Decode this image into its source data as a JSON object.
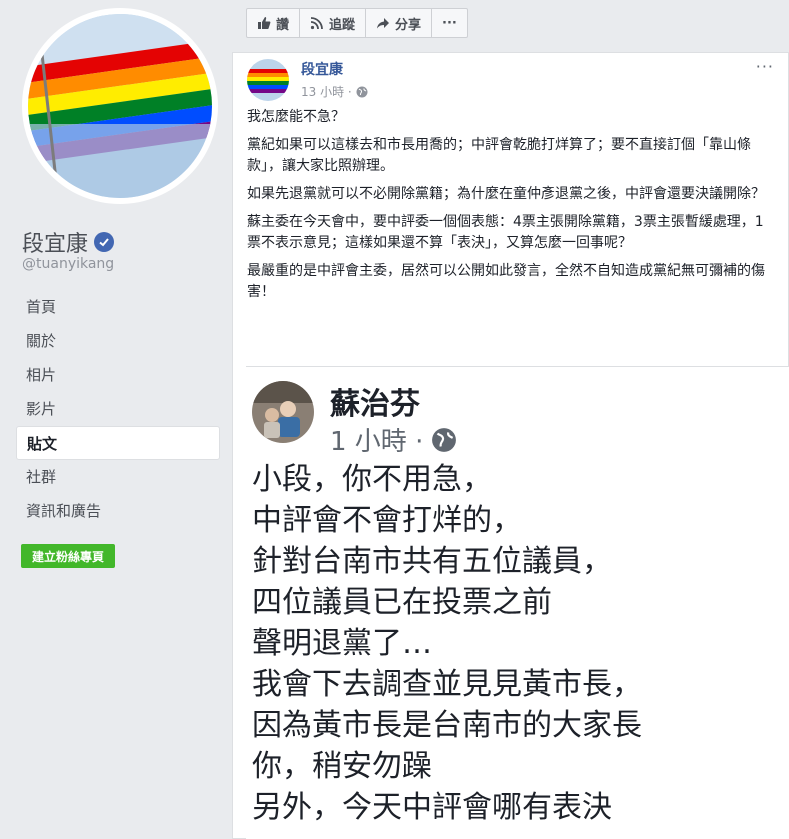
{
  "page": {
    "name": "段宜康",
    "handle": "@tuanyikang"
  },
  "nav": [
    {
      "label": "首頁",
      "active": false
    },
    {
      "label": "關於",
      "active": false
    },
    {
      "label": "相片",
      "active": false
    },
    {
      "label": "影片",
      "active": false
    },
    {
      "label": "貼文",
      "active": true
    },
    {
      "label": "社群",
      "active": false
    },
    {
      "label": "資訊和廣告",
      "active": false
    }
  ],
  "create_page_button": "建立粉絲專頁",
  "actionbar": {
    "like": "讚",
    "follow": "追蹤",
    "share": "分享",
    "more": "···"
  },
  "post": {
    "author": "段宜康",
    "time": "13 小時 ·",
    "more": "···",
    "paragraphs": [
      "我怎麼能不急？",
      "黨紀如果可以這樣去和市長用喬的；中評會乾脆打烊算了；要不直接訂個「靠山條款」，讓大家比照辦理。",
      "如果先退黨就可以不必開除黨籍；為什麼在童仲彥退黨之後，中評會還要決議開除？",
      "蘇主委在今天會中，要中評委一個個表態：4票主張開除黨籍，3票主張暫緩處理，1票不表示意見；這樣如果還不算「表決」，又算怎麼一回事呢？",
      "最嚴重的是中評會主委，居然可以公開如此發言，全然不自知造成黨紀無可彌補的傷害！"
    ]
  },
  "shared_image": {
    "author": "蘇治芬",
    "time": "1 小時 ·",
    "lines": [
      "小段，你不用急，",
      "中評會不會打烊的，",
      "針對台南市共有五位議員，",
      "四位議員已在投票之前",
      "聲明退黨了…",
      "我會下去調查並見見黃市長，",
      "因為黃市長是台南市的大家長",
      "你，稍安勿躁",
      "另外，今天中評會哪有表決"
    ]
  },
  "icons": {
    "verified": "verified-badge-icon",
    "like": "thumbs-up-icon",
    "follow": "rss-icon",
    "share": "share-arrow-icon",
    "globe": "globe-icon"
  },
  "colors": {
    "link_blue": "#365899",
    "verified_blue": "#4267b2",
    "create_green": "#42b72a",
    "background": "#e9ebee"
  }
}
